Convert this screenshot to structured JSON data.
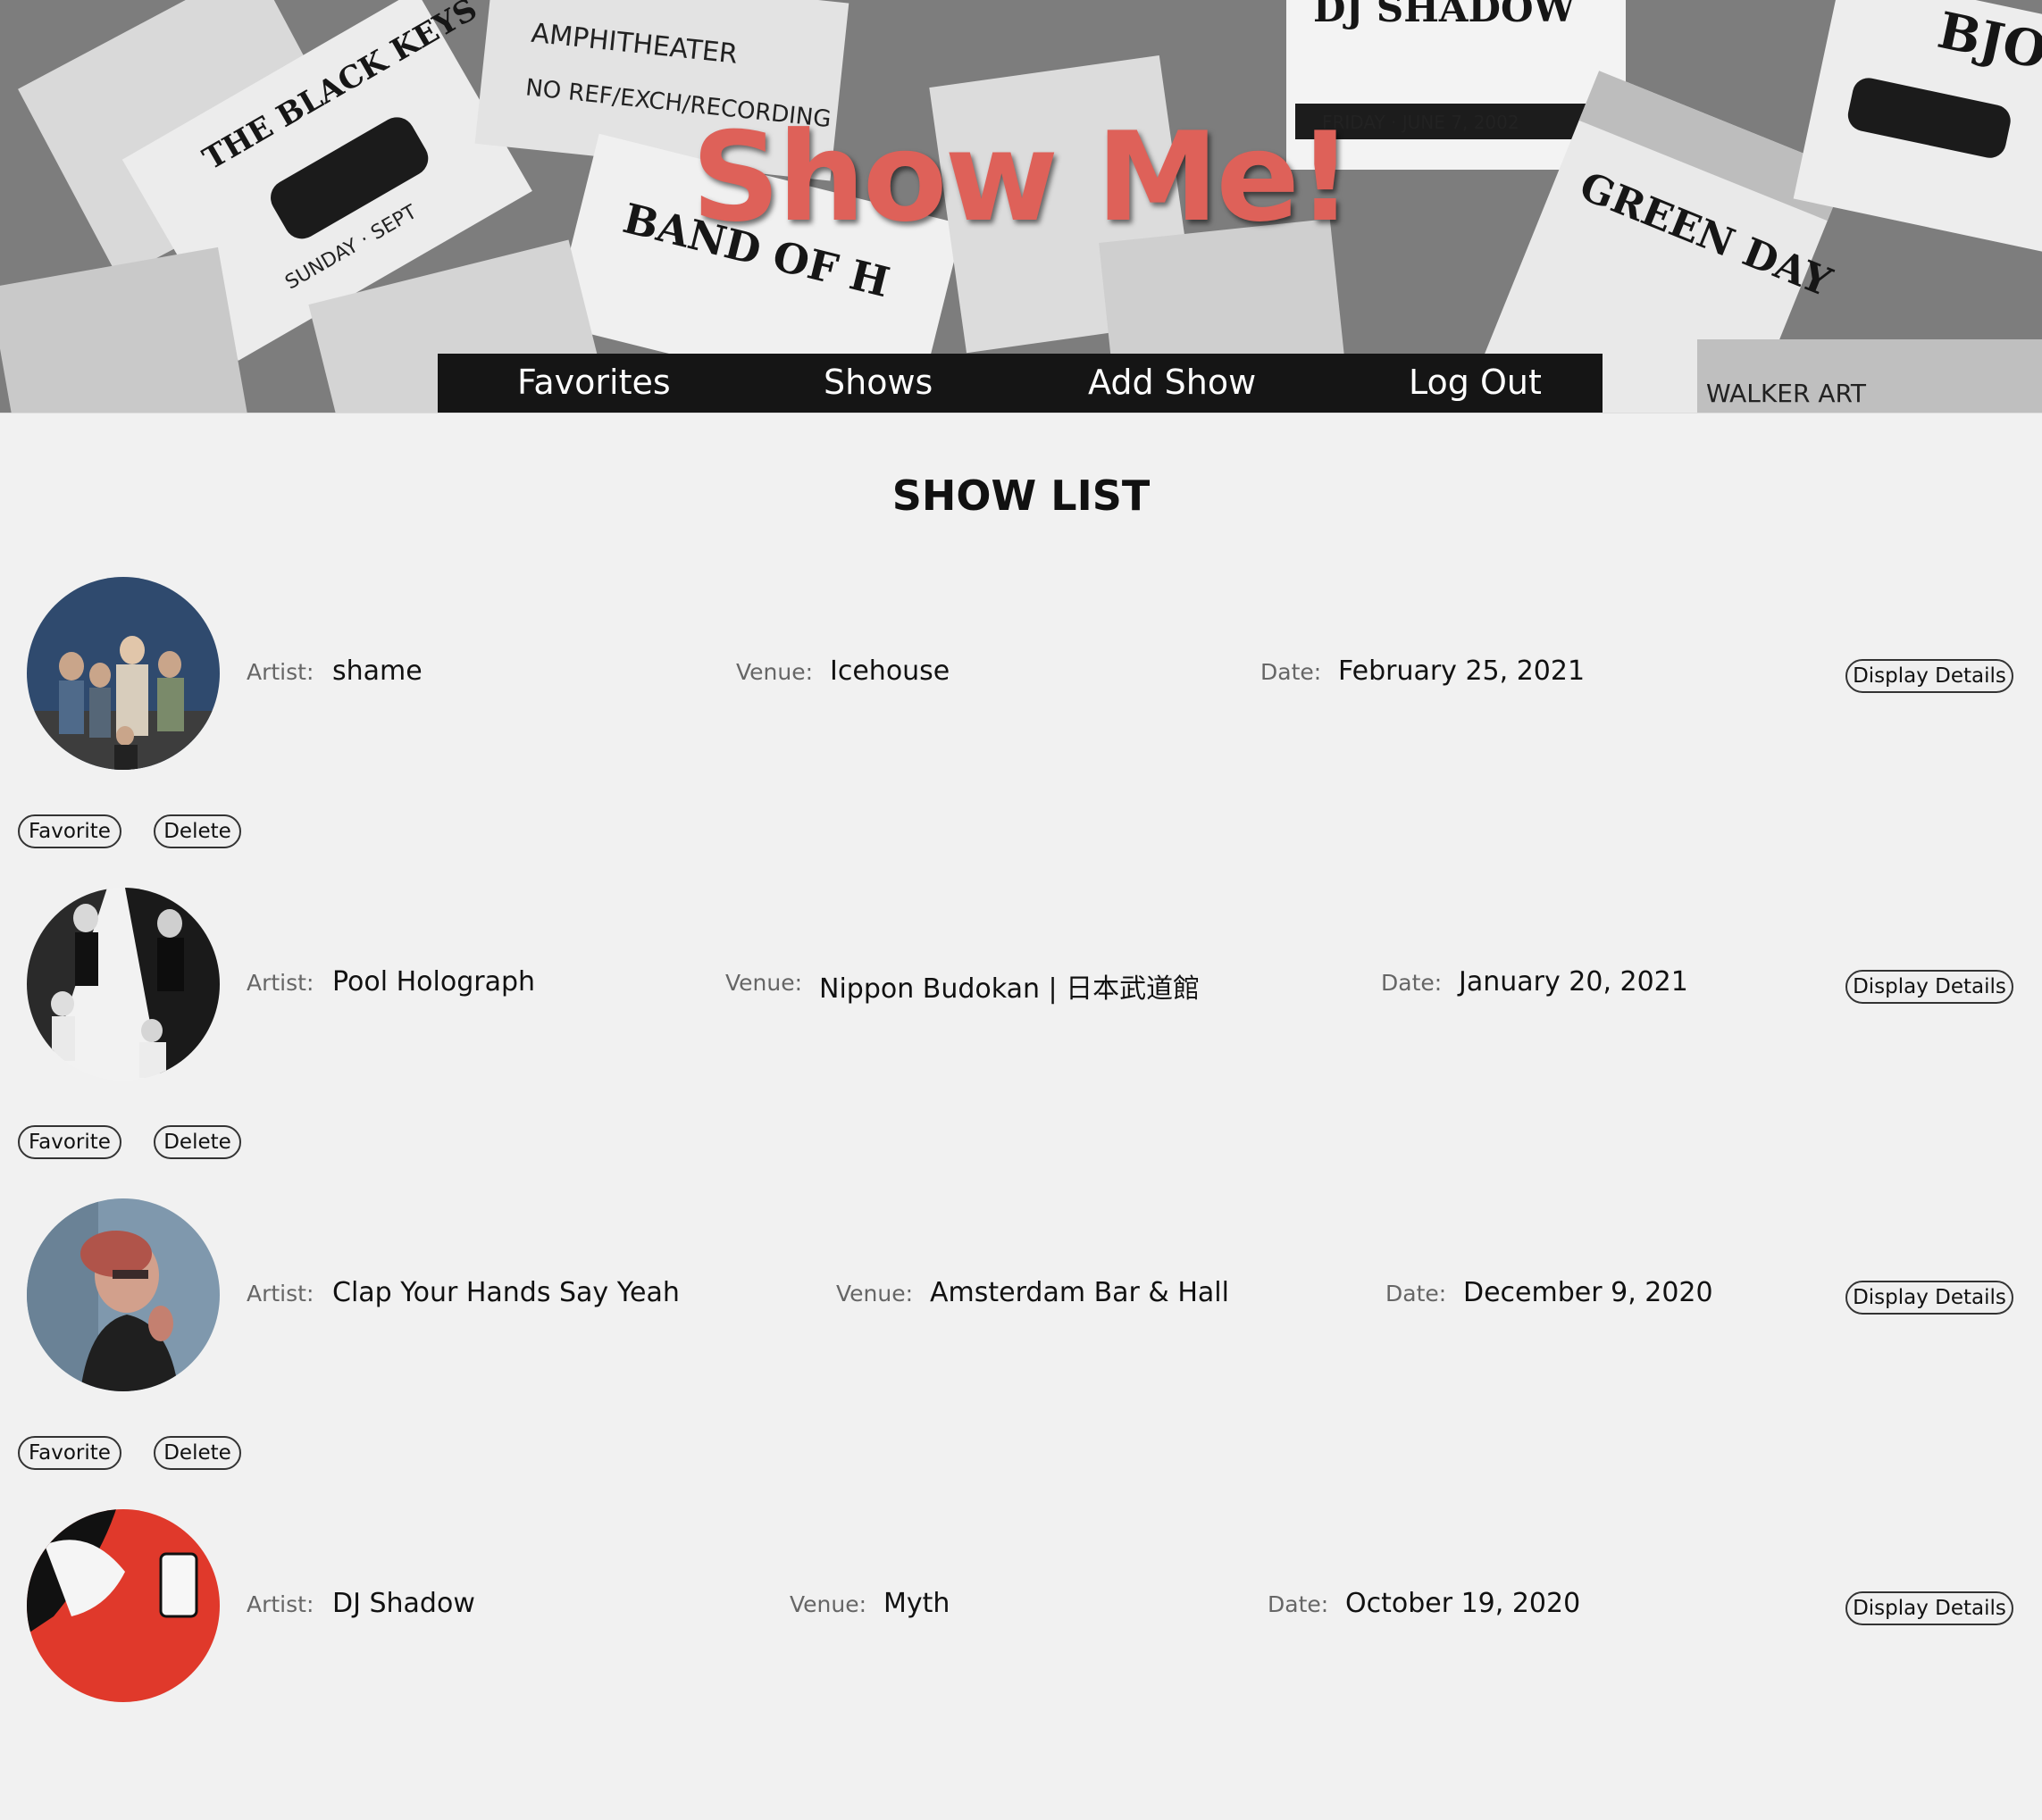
{
  "header": {
    "title": "Show Me!",
    "background_icon": "ticket-collage"
  },
  "nav": {
    "favorites": "Favorites",
    "shows": "Shows",
    "add_show": "Add Show",
    "log_out": "Log Out"
  },
  "main": {
    "heading": "SHOW LIST",
    "labels": {
      "artist": "Artist:",
      "venue": "Venue:",
      "date": "Date:"
    },
    "buttons": {
      "details": "Display Details",
      "favorite": "Favorite",
      "delete": "Delete"
    },
    "shows": [
      {
        "artist": "shame",
        "venue": "Icehouse",
        "date": "February 25, 2021"
      },
      {
        "artist": "Pool Holograph",
        "venue": "Nippon Budokan | 日本武道館",
        "date": "January 20, 2021"
      },
      {
        "artist": "Clap Your Hands Say Yeah",
        "venue": "Amsterdam Bar & Hall",
        "date": "December 9, 2020"
      },
      {
        "artist": "DJ Shadow",
        "venue": "Myth",
        "date": "October 19, 2020"
      }
    ]
  },
  "colors": {
    "accent": "#de6159",
    "nav_bg": "#151515",
    "page_bg": "#f1f1f1"
  }
}
